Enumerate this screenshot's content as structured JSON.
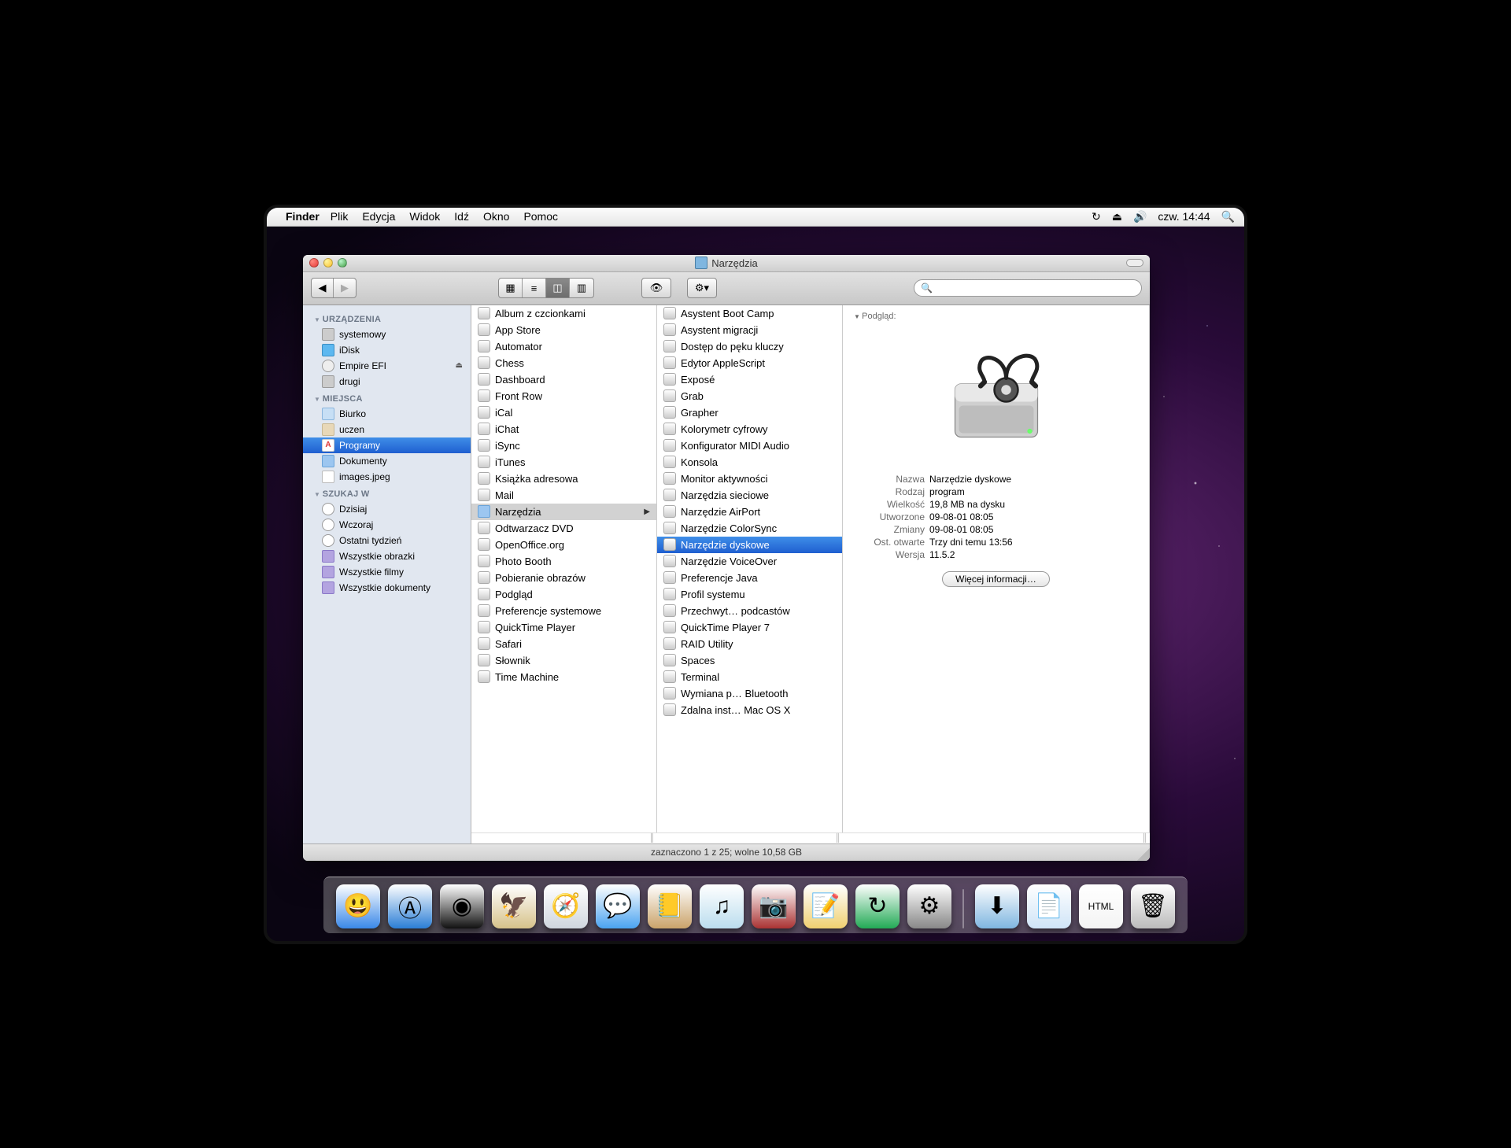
{
  "menubar": {
    "app_name": "Finder",
    "items": [
      "Plik",
      "Edycja",
      "Widok",
      "Idź",
      "Okno",
      "Pomoc"
    ],
    "clock": "czw. 14:44"
  },
  "window": {
    "title": "Narzędzia",
    "search_placeholder": ""
  },
  "sidebar": {
    "devices_header": "URZĄDZENIA",
    "devices": [
      {
        "label": "systemowy",
        "icon": "drive"
      },
      {
        "label": "iDisk",
        "icon": "idisk"
      },
      {
        "label": "Empire EFI",
        "icon": "disc",
        "eject": true
      },
      {
        "label": "drugi",
        "icon": "drive"
      }
    ],
    "places_header": "MIEJSCA",
    "places": [
      {
        "label": "Biurko",
        "icon": "desktop"
      },
      {
        "label": "uczen",
        "icon": "home"
      },
      {
        "label": "Programy",
        "icon": "apps",
        "selected": true
      },
      {
        "label": "Dokumenty",
        "icon": "folder"
      },
      {
        "label": "images.jpeg",
        "icon": "file"
      }
    ],
    "search_header": "SZUKAJ W",
    "search": [
      {
        "label": "Dzisiaj",
        "icon": "clock"
      },
      {
        "label": "Wczoraj",
        "icon": "clock"
      },
      {
        "label": "Ostatni tydzień",
        "icon": "clock"
      },
      {
        "label": "Wszystkie obrazki",
        "icon": "smart"
      },
      {
        "label": "Wszystkie filmy",
        "icon": "smart"
      },
      {
        "label": "Wszystkie dokumenty",
        "icon": "smart"
      }
    ]
  },
  "column1": [
    {
      "label": "Album z czcionkami"
    },
    {
      "label": "App Store"
    },
    {
      "label": "Automator"
    },
    {
      "label": "Chess"
    },
    {
      "label": "Dashboard"
    },
    {
      "label": "Front Row"
    },
    {
      "label": "iCal"
    },
    {
      "label": "iChat"
    },
    {
      "label": "iSync"
    },
    {
      "label": "iTunes"
    },
    {
      "label": "Książka adresowa"
    },
    {
      "label": "Mail"
    },
    {
      "label": "Narzędzia",
      "folder": true,
      "selected": true
    },
    {
      "label": "Odtwarzacz DVD"
    },
    {
      "label": "OpenOffice.org"
    },
    {
      "label": "Photo Booth"
    },
    {
      "label": "Pobieranie obrazów"
    },
    {
      "label": "Podgląd"
    },
    {
      "label": "Preferencje systemowe"
    },
    {
      "label": "QuickTime Player"
    },
    {
      "label": "Safari"
    },
    {
      "label": "Słownik"
    },
    {
      "label": "Time Machine"
    }
  ],
  "column2": [
    {
      "label": "Asystent Boot Camp"
    },
    {
      "label": "Asystent migracji"
    },
    {
      "label": "Dostęp do pęku kluczy"
    },
    {
      "label": "Edytor AppleScript"
    },
    {
      "label": "Exposé"
    },
    {
      "label": "Grab"
    },
    {
      "label": "Grapher"
    },
    {
      "label": "Kolorymetr cyfrowy"
    },
    {
      "label": "Konfigurator MIDI Audio"
    },
    {
      "label": "Konsola"
    },
    {
      "label": "Monitor aktywności"
    },
    {
      "label": "Narzędzia sieciowe"
    },
    {
      "label": "Narzędzie AirPort"
    },
    {
      "label": "Narzędzie ColorSync"
    },
    {
      "label": "Narzędzie dyskowe",
      "selected": true
    },
    {
      "label": "Narzędzie VoiceOver"
    },
    {
      "label": "Preferencje Java"
    },
    {
      "label": "Profil systemu"
    },
    {
      "label": "Przechwyt… podcastów"
    },
    {
      "label": "QuickTime Player 7"
    },
    {
      "label": "RAID Utility"
    },
    {
      "label": "Spaces"
    },
    {
      "label": "Terminal"
    },
    {
      "label": "Wymiana p… Bluetooth"
    },
    {
      "label": "Zdalna inst… Mac OS X"
    }
  ],
  "preview": {
    "header": "Podgląd:",
    "meta": {
      "name_k": "Nazwa",
      "name_v": "Narzędzie dyskowe",
      "kind_k": "Rodzaj",
      "kind_v": "program",
      "size_k": "Wielkość",
      "size_v": "19,8 MB na dysku",
      "created_k": "Utworzone",
      "created_v": "09-08-01 08:05",
      "modified_k": "Zmiany",
      "modified_v": "09-08-01 08:05",
      "opened_k": "Ost. otwarte",
      "opened_v": "Trzy dni temu 13:56",
      "version_k": "Wersja",
      "version_v": "11.5.2"
    },
    "more_info": "Więcej informacji…"
  },
  "statusbar": "zaznaczono 1 z 25; wolne 10,58 GB",
  "dock": [
    "finder",
    "appstore",
    "dashboard",
    "mail",
    "safari",
    "ichat",
    "addressbook",
    "itunes",
    "photobooth",
    "stickies",
    "timemachine",
    "sysprefs",
    "sep",
    "downloads",
    "documents",
    "html",
    "trash"
  ]
}
